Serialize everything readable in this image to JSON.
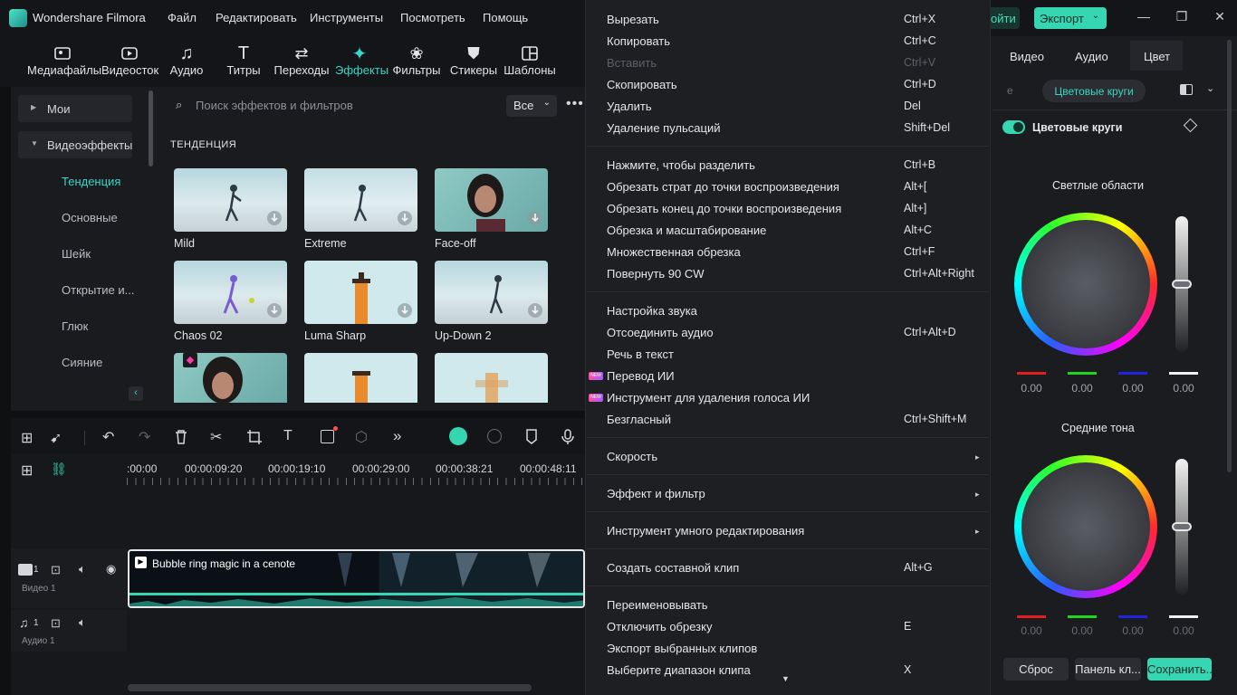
{
  "app": {
    "title": "Wondershare Filmora",
    "menu": [
      "Файл",
      "Редактировать",
      "Инструменты",
      "Посмотреть",
      "Помощь"
    ],
    "green_button": "ойти",
    "export_label": "Экспорт"
  },
  "toolbar": {
    "items": [
      {
        "label": "Медиафайлы",
        "icon": "media-icon"
      },
      {
        "label": "Видеосток",
        "icon": "stock-video-icon"
      },
      {
        "label": "Аудио",
        "icon": "music-icon"
      },
      {
        "label": "Титры",
        "icon": "text-icon"
      },
      {
        "label": "Переходы",
        "icon": "transition-icon"
      },
      {
        "label": "Эффекты",
        "icon": "effects-icon"
      },
      {
        "label": "Фильтры",
        "icon": "filters-icon"
      },
      {
        "label": "Стикеры",
        "icon": "stickers-icon"
      },
      {
        "label": "Шаблоны",
        "icon": "templates-icon"
      }
    ],
    "active": "Эффекты"
  },
  "sidebar": {
    "groups": [
      "Мои",
      "Видеоэффекты"
    ],
    "subitems": [
      "Тенденция",
      "Основные",
      "Шейк",
      "Открытие и...",
      "Глюк",
      "Сияние"
    ],
    "active": "Тенденция"
  },
  "effects": {
    "search_placeholder": "Поиск эффектов и фильтров",
    "filter_value": "Все",
    "section_title": "ТЕНДЕНЦИЯ",
    "items": [
      "Mild",
      "Extreme",
      "Face-off",
      "Chaos 02",
      "Luma Sharp",
      "Up-Down 2",
      "",
      "",
      ""
    ]
  },
  "timeline": {
    "timecodes": [
      ":00:00",
      "00:00:09:20",
      "00:00:19:10",
      "00:00:29:00",
      "00:00:38:21",
      "00:00:48:11"
    ],
    "video_track_label": "Видео 1",
    "video_track_num": "1",
    "audio_track_label": "Аудио 1",
    "audio_track_num": "1",
    "clip_title": "Bubble ring magic in a cenote"
  },
  "context_menu": {
    "groups": [
      [
        {
          "label": "Вырезать",
          "shortcut": "Ctrl+X"
        },
        {
          "label": "Копировать",
          "shortcut": "Ctrl+C"
        },
        {
          "label": "Вставить",
          "shortcut": "Ctrl+V",
          "disabled": true
        },
        {
          "label": "Скопировать",
          "shortcut": "Ctrl+D"
        },
        {
          "label": "Удалить",
          "shortcut": "Del"
        },
        {
          "label": "Удаление пульсаций",
          "shortcut": "Shift+Del"
        }
      ],
      [
        {
          "label": "Нажмите, чтобы разделить",
          "shortcut": "Ctrl+B"
        },
        {
          "label": "Обрезать страт до точки воспроизведения",
          "shortcut": "Alt+["
        },
        {
          "label": "Обрезать конец до точки воспроизведения",
          "shortcut": "Alt+]"
        },
        {
          "label": "Обрезка и масштабирование",
          "shortcut": "Alt+C"
        },
        {
          "label": "Множественная обрезка",
          "shortcut": "Ctrl+F"
        },
        {
          "label": "Повернуть 90 CW",
          "shortcut": "Ctrl+Alt+Right"
        }
      ],
      [
        {
          "label": "Настройка звука",
          "shortcut": ""
        },
        {
          "label": "Отсоединить аудио",
          "shortcut": "Ctrl+Alt+D"
        },
        {
          "label": "Речь в текст",
          "shortcut": ""
        },
        {
          "label": "Перевод ИИ",
          "shortcut": "",
          "badge": "NEW"
        },
        {
          "label": "Инструмент для удаления голоса ИИ",
          "shortcut": "",
          "badge": "NEW"
        },
        {
          "label": "Безгласный",
          "shortcut": "Ctrl+Shift+M"
        }
      ],
      [
        {
          "label": "Скорость",
          "submenu": true
        }
      ],
      [
        {
          "label": "Эффект и фильтр",
          "submenu": true
        }
      ],
      [
        {
          "label": "Инструмент умного редактирования",
          "submenu": true
        }
      ],
      [
        {
          "label": "Создать составной клип",
          "shortcut": "Alt+G"
        }
      ],
      [
        {
          "label": "Переименовывать",
          "shortcut": ""
        },
        {
          "label": "Отключить обрезку",
          "shortcut": "E"
        },
        {
          "label": "Экспорт выбранных клипов",
          "shortcut": ""
        },
        {
          "label": "Выберите диапазон клипа",
          "shortcut": "X"
        }
      ]
    ]
  },
  "right_panel": {
    "tabs": [
      "Видео",
      "Аудио",
      "Цвет"
    ],
    "active_tab": "Цвет",
    "partial_label": "е",
    "subtab": "Цветовые круги",
    "toggle_label": "Цветовые круги",
    "toggle_on": true,
    "wheels": [
      {
        "title": "Светлые области",
        "values": [
          "0.00",
          "0.00",
          "0.00",
          "0.00"
        ],
        "slider_level": 0.5
      },
      {
        "title": "Средние тона",
        "values": [
          "0.00",
          "0.00",
          "0.00",
          "0.00"
        ],
        "slider_level": 0.5
      }
    ],
    "channel_colors": [
      "#e02020",
      "#22d422",
      "#2222e0",
      "#f0f0f0"
    ],
    "buttons": {
      "reset": "Сброс",
      "panel": "Панель кл...",
      "save": "Сохранить..."
    }
  },
  "colors": {
    "accent": "#37d6c7",
    "export": "#37d6b2"
  }
}
